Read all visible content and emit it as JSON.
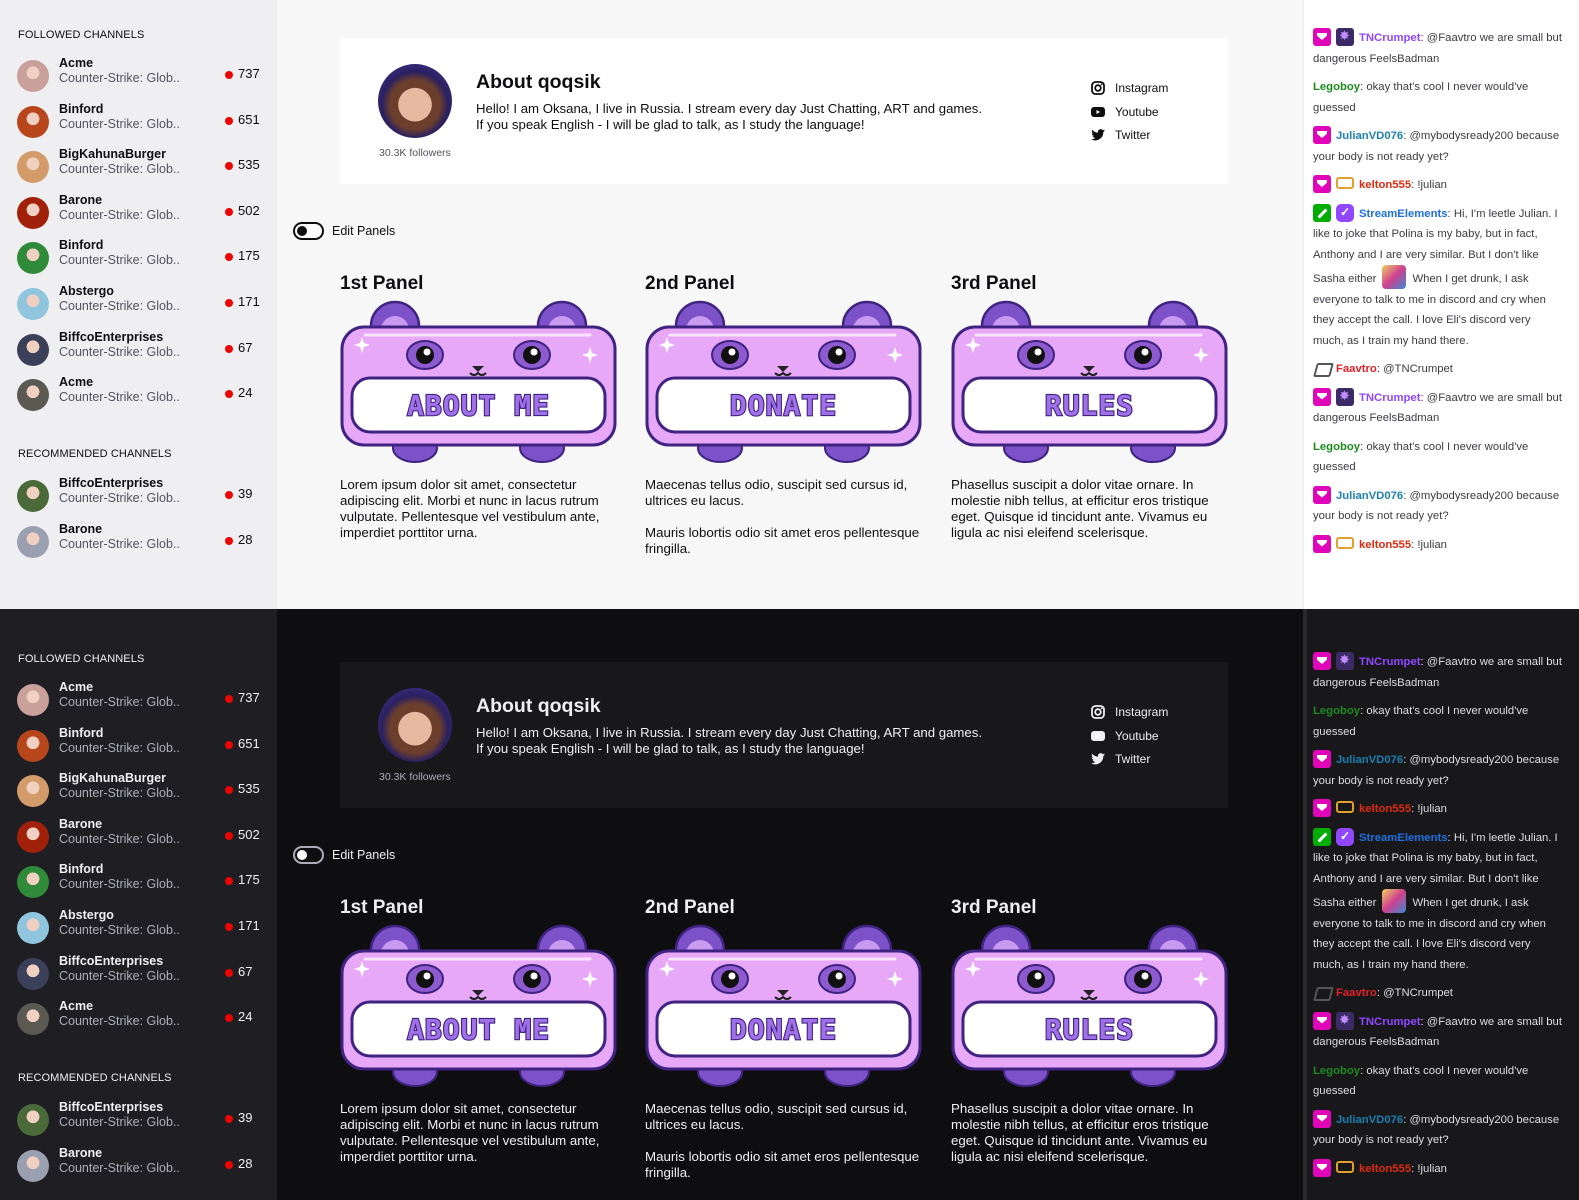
{
  "sidebar": {
    "followed_heading": "FOLLOWED CHANNELS",
    "recommended_heading": "RECOMMENDED CHANNELS",
    "followed": [
      {
        "name": "Acme",
        "game": "Counter-Strike: Glob..",
        "viewers": "737",
        "avatar_color": "#c9a09a"
      },
      {
        "name": "Binford",
        "game": "Counter-Strike: Glob..",
        "viewers": "651",
        "avatar_color": "#b8461c"
      },
      {
        "name": "BigKahunaBurger",
        "game": "Counter-Strike: Glob..",
        "viewers": "535",
        "avatar_color": "#d39a6a"
      },
      {
        "name": "Barone",
        "game": "Counter-Strike: Glob..",
        "viewers": "502",
        "avatar_color": "#a0200a"
      },
      {
        "name": "Binford",
        "game": "Counter-Strike: Glob..",
        "viewers": "175",
        "avatar_color": "#2f8a3a"
      },
      {
        "name": "Abstergo",
        "game": "Counter-Strike: Glob..",
        "viewers": "171",
        "avatar_color": "#8fc6dd"
      },
      {
        "name": "BiffcoEnterprises",
        "game": "Counter-Strike: Glob..",
        "viewers": "67",
        "avatar_color": "#3a4058"
      },
      {
        "name": "Acme",
        "game": "Counter-Strike: Glob..",
        "viewers": "24",
        "avatar_color": "#5a5a52"
      }
    ],
    "recommended": [
      {
        "name": "BiffcoEnterprises",
        "game": "Counter-Strike: Glob..",
        "viewers": "39",
        "avatar_color": "#4a6a3a"
      },
      {
        "name": "Barone",
        "game": "Counter-Strike: Glob..",
        "viewers": "28",
        "avatar_color": "#9aa0b0"
      }
    ]
  },
  "about": {
    "title": "About qoqsik",
    "followers": "30.3K followers",
    "description_line1": "Hello! I am Oksana, I live in Russia. I stream every day Just Chatting, ART and games.",
    "description_line2": "If you speak English - I will be glad to talk, as I study the language!",
    "links": [
      {
        "label": "Instagram",
        "icon": "instagram-icon"
      },
      {
        "label": "Youtube",
        "icon": "youtube-icon"
      },
      {
        "label": "Twitter",
        "icon": "twitter-icon"
      }
    ]
  },
  "edit_panels_label": "Edit Panels",
  "panels": [
    {
      "title": "1st Panel",
      "banner": "ABOUT ME",
      "text": "Lorem ipsum dolor sit amet, consectetur adipiscing elit. Morbi et nunc in lacus rutrum vulputate. Pellentesque vel vestibulum ante, imperdiet porttitor urna."
    },
    {
      "title": "2nd Panel",
      "banner": "DONATE",
      "text": "Maecenas tellus odio, suscipit sed cursus id, ultrices eu lacus.\n\nMauris lobortis odio sit amet eros pellentesque fringilla."
    },
    {
      "title": "3rd Panel",
      "banner": "RULES",
      "text": "Phasellus suscipit a dolor vitae ornare. In molestie nibh tellus, at efficitur eros tristique eget. Quisque id tincidunt ante. Vivamus eu ligula ac nisi eleifend scelerisque."
    }
  ],
  "colors": {
    "accent": "#9147ff",
    "live": "#eb0400",
    "banner_fill": "#e8a8f8",
    "banner_outline": "#4a2a8a"
  },
  "chat": [
    {
      "badges": [
        "sub",
        "star"
      ],
      "user": "TNCrumpet",
      "color": "#9147ff",
      "text": "@Faavtro we are small but dangerous FeelsBadman"
    },
    {
      "badges": [],
      "user": "Legoboy",
      "color": "#1e8a1e",
      "text": "okay that's cool I never would've guessed"
    },
    {
      "badges": [
        "sub"
      ],
      "user": "JulianVD076",
      "color": "#1b7fb0",
      "text": "@mybodysready200 because your body is not ready yet?"
    },
    {
      "badges": [
        "sub",
        "bits"
      ],
      "user": "kelton555",
      "color": "#e02a0e",
      "text": "!julian"
    },
    {
      "badges": [
        "mod",
        "ver"
      ],
      "user": "StreamElements",
      "color": "#1e6fe0",
      "text": "Hi, I'm leetle Julian. I like to joke that Polina is my baby, but in fact, Anthony and I are very similar. But I don't like Sasha either",
      "emote": "emote",
      "text_after": "When I get drunk, I ask everyone to talk to me in discord and cry when they accept the call. I love Eli's discord very much, as I train my hand there."
    },
    {
      "badges": [
        "bot"
      ],
      "user": "Faavtro",
      "color": "#e0202a",
      "text": "@TNCrumpet"
    },
    {
      "badges": [
        "sub",
        "star"
      ],
      "user": "TNCrumpet",
      "color": "#9147ff",
      "text": "@Faavtro we are small but dangerous FeelsBadman"
    },
    {
      "badges": [],
      "user": "Legoboy",
      "color": "#1e8a1e",
      "text": "okay that's cool I never would've guessed"
    },
    {
      "badges": [
        "sub"
      ],
      "user": "JulianVD076",
      "color": "#1b7fb0",
      "text": "@mybodysready200 because your body is not ready yet?"
    },
    {
      "badges": [
        "sub",
        "bits"
      ],
      "user": "kelton555",
      "color": "#e02a0e",
      "text": "!julian"
    }
  ]
}
